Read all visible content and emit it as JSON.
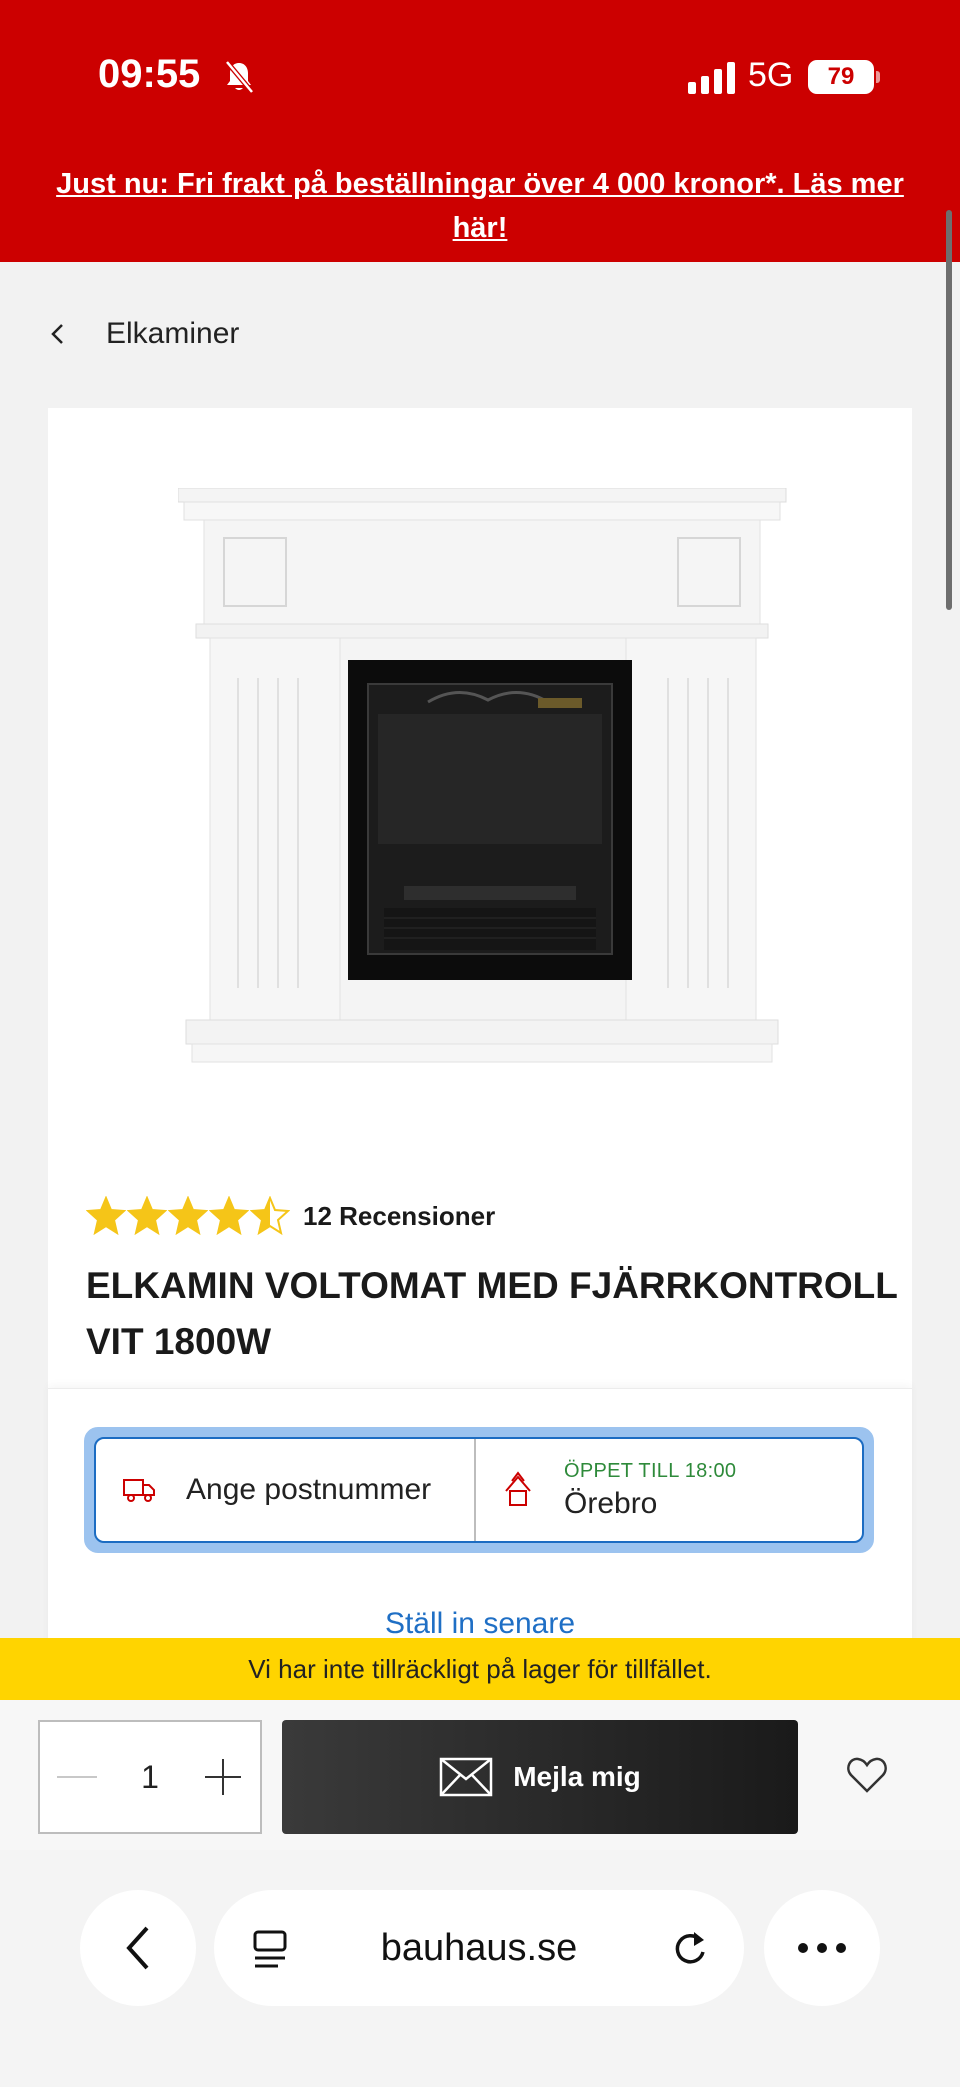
{
  "status_bar": {
    "time": "09:55",
    "network": "5G",
    "battery": "79",
    "icons": [
      "bell-muted-icon",
      "signal-icon"
    ]
  },
  "promo_banner": {
    "text": "Just nu: Fri frakt på beställningar över 4 000 kronor*. Läs mer här!"
  },
  "breadcrumb": {
    "label": "Elkaminer",
    "icon": "chevron-left-icon"
  },
  "product": {
    "rating_value": 4.5,
    "rating_max": 5,
    "reviews_label": "12 Recensioner",
    "title": "ELKAMIN VOLTOMAT MED FJÄRRKONTROLL VIT 1800W"
  },
  "delivery": {
    "postcode_label": "Ange postnummer",
    "store_status": "ÖPPET TILL 18:00",
    "store_name": "Örebro",
    "set_later": "Ställ in senare"
  },
  "stock_notice": "Vi har inte tillräckligt på lager för tillfället.",
  "purchase": {
    "quantity": "1",
    "notify_label": "Mejla mig"
  },
  "browser": {
    "url": "bauhaus.se"
  },
  "colors": {
    "brand_red": "#cc0000",
    "stock_yellow": "#ffd400",
    "link_blue": "#1f6fc5",
    "open_green": "#2e8a3a",
    "star_yellow": "#f5c518"
  }
}
